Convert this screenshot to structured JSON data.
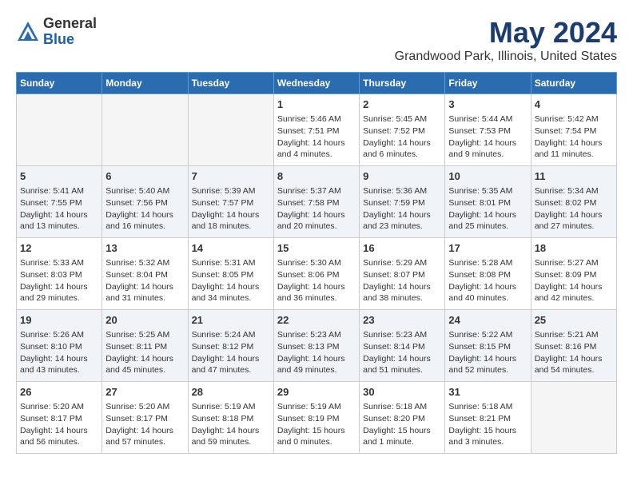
{
  "logo": {
    "general": "General",
    "blue": "Blue"
  },
  "title": "May 2024",
  "subtitle": "Grandwood Park, Illinois, United States",
  "days_of_week": [
    "Sunday",
    "Monday",
    "Tuesday",
    "Wednesday",
    "Thursday",
    "Friday",
    "Saturday"
  ],
  "weeks": [
    {
      "days": [
        {
          "num": "",
          "info": ""
        },
        {
          "num": "",
          "info": ""
        },
        {
          "num": "",
          "info": ""
        },
        {
          "num": "1",
          "info": "Sunrise: 5:46 AM\nSunset: 7:51 PM\nDaylight: 14 hours\nand 4 minutes."
        },
        {
          "num": "2",
          "info": "Sunrise: 5:45 AM\nSunset: 7:52 PM\nDaylight: 14 hours\nand 6 minutes."
        },
        {
          "num": "3",
          "info": "Sunrise: 5:44 AM\nSunset: 7:53 PM\nDaylight: 14 hours\nand 9 minutes."
        },
        {
          "num": "4",
          "info": "Sunrise: 5:42 AM\nSunset: 7:54 PM\nDaylight: 14 hours\nand 11 minutes."
        }
      ]
    },
    {
      "days": [
        {
          "num": "5",
          "info": "Sunrise: 5:41 AM\nSunset: 7:55 PM\nDaylight: 14 hours\nand 13 minutes."
        },
        {
          "num": "6",
          "info": "Sunrise: 5:40 AM\nSunset: 7:56 PM\nDaylight: 14 hours\nand 16 minutes."
        },
        {
          "num": "7",
          "info": "Sunrise: 5:39 AM\nSunset: 7:57 PM\nDaylight: 14 hours\nand 18 minutes."
        },
        {
          "num": "8",
          "info": "Sunrise: 5:37 AM\nSunset: 7:58 PM\nDaylight: 14 hours\nand 20 minutes."
        },
        {
          "num": "9",
          "info": "Sunrise: 5:36 AM\nSunset: 7:59 PM\nDaylight: 14 hours\nand 23 minutes."
        },
        {
          "num": "10",
          "info": "Sunrise: 5:35 AM\nSunset: 8:01 PM\nDaylight: 14 hours\nand 25 minutes."
        },
        {
          "num": "11",
          "info": "Sunrise: 5:34 AM\nSunset: 8:02 PM\nDaylight: 14 hours\nand 27 minutes."
        }
      ]
    },
    {
      "days": [
        {
          "num": "12",
          "info": "Sunrise: 5:33 AM\nSunset: 8:03 PM\nDaylight: 14 hours\nand 29 minutes."
        },
        {
          "num": "13",
          "info": "Sunrise: 5:32 AM\nSunset: 8:04 PM\nDaylight: 14 hours\nand 31 minutes."
        },
        {
          "num": "14",
          "info": "Sunrise: 5:31 AM\nSunset: 8:05 PM\nDaylight: 14 hours\nand 34 minutes."
        },
        {
          "num": "15",
          "info": "Sunrise: 5:30 AM\nSunset: 8:06 PM\nDaylight: 14 hours\nand 36 minutes."
        },
        {
          "num": "16",
          "info": "Sunrise: 5:29 AM\nSunset: 8:07 PM\nDaylight: 14 hours\nand 38 minutes."
        },
        {
          "num": "17",
          "info": "Sunrise: 5:28 AM\nSunset: 8:08 PM\nDaylight: 14 hours\nand 40 minutes."
        },
        {
          "num": "18",
          "info": "Sunrise: 5:27 AM\nSunset: 8:09 PM\nDaylight: 14 hours\nand 42 minutes."
        }
      ]
    },
    {
      "days": [
        {
          "num": "19",
          "info": "Sunrise: 5:26 AM\nSunset: 8:10 PM\nDaylight: 14 hours\nand 43 minutes."
        },
        {
          "num": "20",
          "info": "Sunrise: 5:25 AM\nSunset: 8:11 PM\nDaylight: 14 hours\nand 45 minutes."
        },
        {
          "num": "21",
          "info": "Sunrise: 5:24 AM\nSunset: 8:12 PM\nDaylight: 14 hours\nand 47 minutes."
        },
        {
          "num": "22",
          "info": "Sunrise: 5:23 AM\nSunset: 8:13 PM\nDaylight: 14 hours\nand 49 minutes."
        },
        {
          "num": "23",
          "info": "Sunrise: 5:23 AM\nSunset: 8:14 PM\nDaylight: 14 hours\nand 51 minutes."
        },
        {
          "num": "24",
          "info": "Sunrise: 5:22 AM\nSunset: 8:15 PM\nDaylight: 14 hours\nand 52 minutes."
        },
        {
          "num": "25",
          "info": "Sunrise: 5:21 AM\nSunset: 8:16 PM\nDaylight: 14 hours\nand 54 minutes."
        }
      ]
    },
    {
      "days": [
        {
          "num": "26",
          "info": "Sunrise: 5:20 AM\nSunset: 8:17 PM\nDaylight: 14 hours\nand 56 minutes."
        },
        {
          "num": "27",
          "info": "Sunrise: 5:20 AM\nSunset: 8:17 PM\nDaylight: 14 hours\nand 57 minutes."
        },
        {
          "num": "28",
          "info": "Sunrise: 5:19 AM\nSunset: 8:18 PM\nDaylight: 14 hours\nand 59 minutes."
        },
        {
          "num": "29",
          "info": "Sunrise: 5:19 AM\nSunset: 8:19 PM\nDaylight: 15 hours\nand 0 minutes."
        },
        {
          "num": "30",
          "info": "Sunrise: 5:18 AM\nSunset: 8:20 PM\nDaylight: 15 hours\nand 1 minute."
        },
        {
          "num": "31",
          "info": "Sunrise: 5:18 AM\nSunset: 8:21 PM\nDaylight: 15 hours\nand 3 minutes."
        },
        {
          "num": "",
          "info": ""
        }
      ]
    }
  ]
}
